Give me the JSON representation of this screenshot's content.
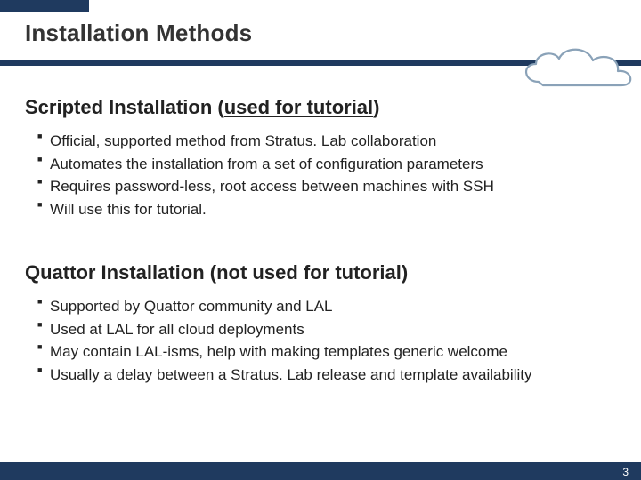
{
  "title": "Installation Methods",
  "sections": [
    {
      "heading_pre": "Scripted Installation (",
      "heading_em": "used for tutorial",
      "heading_post": ")",
      "bullets": [
        "Official, supported method from Stratus. Lab collaboration",
        "Automates the installation from a set of configuration parameters",
        "Requires password-less, root access between machines with SSH",
        "Will use this for tutorial."
      ]
    },
    {
      "heading_pre": "Quattor Installation (not used for tutorial)",
      "heading_em": "",
      "heading_post": "",
      "bullets": [
        "Supported by Quattor community and LAL",
        "Used at LAL for all cloud deployments",
        "May contain LAL-isms, help with making templates generic welcome",
        "Usually a delay between a Stratus. Lab release and template availability"
      ]
    }
  ],
  "page_number": "3",
  "colors": {
    "accent": "#1f3a5f"
  }
}
